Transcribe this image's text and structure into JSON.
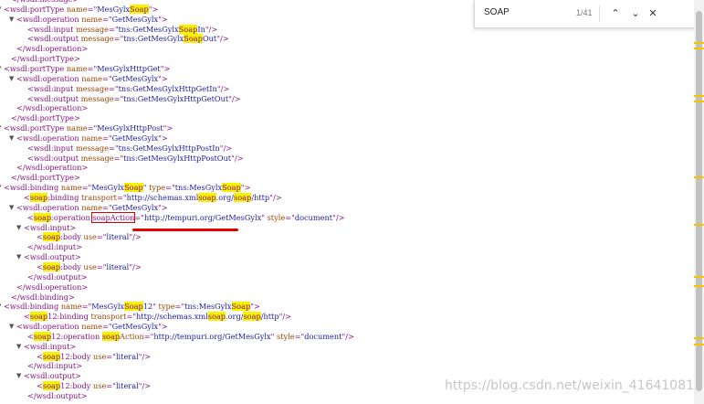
{
  "find_bar": {
    "query": "SOAP",
    "match_count": "1/41",
    "prev_icon": "chevron-up-icon",
    "next_icon": "chevron-down-icon",
    "close_icon": "close-icon",
    "prev_glyph": "⌃",
    "next_glyph": "⌄",
    "close_glyph": "✕"
  },
  "watermark": "https://blog.csdn.net/weixin_41641081",
  "colors": {
    "highlight": "#f8f200",
    "annotation": "#e60000"
  },
  "lines": [
    [
      [
        "t",
        "</wsdl:message>"
      ]
    ],
    [
      [
        "t",
        "<wsdl:portType "
      ],
      [
        "an",
        "name"
      ],
      [
        "t",
        "=\""
      ],
      [
        "av",
        "MesGylx"
      ],
      [
        "hl",
        "Soap"
      ],
      [
        "t",
        "\">"
      ]
    ],
    [
      [
        "t",
        "<wsdl:operation "
      ],
      [
        "an",
        "name"
      ],
      [
        "t",
        "=\""
      ],
      [
        "av",
        "GetMesGylx"
      ],
      [
        "t",
        "\">"
      ]
    ],
    [
      [
        "t",
        "<wsdl:input "
      ],
      [
        "an",
        "message"
      ],
      [
        "t",
        "=\""
      ],
      [
        "av",
        "tns:GetMesGylx"
      ],
      [
        "hl",
        "Soap"
      ],
      [
        "av",
        "In"
      ],
      [
        "t",
        "\"/>"
      ]
    ],
    [
      [
        "t",
        "<wsdl:output "
      ],
      [
        "an",
        "message"
      ],
      [
        "t",
        "=\""
      ],
      [
        "av",
        "tns:GetMesGylx"
      ],
      [
        "hl",
        "Soap"
      ],
      [
        "av",
        "Out"
      ],
      [
        "t",
        "\"/>"
      ]
    ],
    [
      [
        "t",
        "</wsdl:operation>"
      ]
    ],
    [
      [
        "t",
        "</wsdl:portType>"
      ]
    ],
    [
      [
        "t",
        "<wsdl:portType "
      ],
      [
        "an",
        "name"
      ],
      [
        "t",
        "=\""
      ],
      [
        "av",
        "MesGylxHttpGet"
      ],
      [
        "t",
        "\">"
      ]
    ],
    [
      [
        "t",
        "<wsdl:operation "
      ],
      [
        "an",
        "name"
      ],
      [
        "t",
        "=\""
      ],
      [
        "av",
        "GetMesGylx"
      ],
      [
        "t",
        "\">"
      ]
    ],
    [
      [
        "t",
        "<wsdl:input "
      ],
      [
        "an",
        "message"
      ],
      [
        "t",
        "=\""
      ],
      [
        "av",
        "tns:GetMesGylxHttpGetIn"
      ],
      [
        "t",
        "\"/>"
      ]
    ],
    [
      [
        "t",
        "<wsdl:output "
      ],
      [
        "an",
        "message"
      ],
      [
        "t",
        "=\""
      ],
      [
        "av",
        "tns:GetMesGylxHttpGetOut"
      ],
      [
        "t",
        "\"/>"
      ]
    ],
    [
      [
        "t",
        "</wsdl:operation>"
      ]
    ],
    [
      [
        "t",
        "</wsdl:portType>"
      ]
    ],
    [
      [
        "t",
        "<wsdl:portType "
      ],
      [
        "an",
        "name"
      ],
      [
        "t",
        "=\""
      ],
      [
        "av",
        "MesGylxHttpPost"
      ],
      [
        "t",
        "\">"
      ]
    ],
    [
      [
        "t",
        "<wsdl:operation "
      ],
      [
        "an",
        "name"
      ],
      [
        "t",
        "=\""
      ],
      [
        "av",
        "GetMesGylx"
      ],
      [
        "t",
        "\">"
      ]
    ],
    [
      [
        "t",
        "<wsdl:input "
      ],
      [
        "an",
        "message"
      ],
      [
        "t",
        "=\""
      ],
      [
        "av",
        "tns:GetMesGylxHttpPostIn"
      ],
      [
        "t",
        "\"/>"
      ]
    ],
    [
      [
        "t",
        "<wsdl:output "
      ],
      [
        "an",
        "message"
      ],
      [
        "t",
        "=\""
      ],
      [
        "av",
        "tns:GetMesGylxHttpPostOut"
      ],
      [
        "t",
        "\"/>"
      ]
    ],
    [
      [
        "t",
        "</wsdl:operation>"
      ]
    ],
    [
      [
        "t",
        "</wsdl:portType>"
      ]
    ],
    [
      [
        "t",
        "<wsdl:binding "
      ],
      [
        "an",
        "name"
      ],
      [
        "t",
        "=\""
      ],
      [
        "av",
        "MesGylx"
      ],
      [
        "hl",
        "Soap"
      ],
      [
        "t",
        "\" "
      ],
      [
        "an",
        "type"
      ],
      [
        "t",
        "=\""
      ],
      [
        "av",
        "tns:MesGylx"
      ],
      [
        "hl",
        "Soap"
      ],
      [
        "t",
        "\">"
      ]
    ],
    [
      [
        "t",
        "<"
      ],
      [
        "hl",
        "soap"
      ],
      [
        "t",
        ":binding "
      ],
      [
        "an",
        "transport"
      ],
      [
        "t",
        "=\""
      ],
      [
        "av",
        "http://schemas.xml"
      ],
      [
        "hl",
        "soap"
      ],
      [
        "av",
        ".org/"
      ],
      [
        "hl",
        "soap"
      ],
      [
        "av",
        "/http"
      ],
      [
        "t",
        "\"/>"
      ]
    ],
    [
      [
        "t",
        "<wsdl:operation "
      ],
      [
        "an",
        "name"
      ],
      [
        "t",
        "=\""
      ],
      [
        "av",
        "GetMesGylx"
      ],
      [
        "t",
        "\">"
      ]
    ],
    [
      [
        "t",
        "<"
      ],
      [
        "hl",
        "soap"
      ],
      [
        "t",
        ":operation "
      ],
      [
        "cur",
        "soapAction"
      ],
      [
        "t",
        "=\""
      ],
      [
        "av",
        "http://tempuri.org/GetMesGylx"
      ],
      [
        "t",
        "\" "
      ],
      [
        "an",
        "style"
      ],
      [
        "t",
        "=\""
      ],
      [
        "av",
        "document"
      ],
      [
        "t",
        "\"/>"
      ]
    ],
    [
      [
        "t",
        "<wsdl:input>"
      ]
    ],
    [
      [
        "t",
        "<"
      ],
      [
        "hl",
        "soap"
      ],
      [
        "t",
        ":body "
      ],
      [
        "an",
        "use"
      ],
      [
        "t",
        "=\""
      ],
      [
        "av",
        "literal"
      ],
      [
        "t",
        "\"/>"
      ]
    ],
    [
      [
        "t",
        "</wsdl:input>"
      ]
    ],
    [
      [
        "t",
        "<wsdl:output>"
      ]
    ],
    [
      [
        "t",
        "<"
      ],
      [
        "hl",
        "soap"
      ],
      [
        "t",
        ":body "
      ],
      [
        "an",
        "use"
      ],
      [
        "t",
        "=\""
      ],
      [
        "av",
        "literal"
      ],
      [
        "t",
        "\"/>"
      ]
    ],
    [
      [
        "t",
        "</wsdl:output>"
      ]
    ],
    [
      [
        "t",
        "</wsdl:operation>"
      ]
    ],
    [
      [
        "t",
        "</wsdl:binding>"
      ]
    ],
    [
      [
        "t",
        "<wsdl:binding "
      ],
      [
        "an",
        "name"
      ],
      [
        "t",
        "=\""
      ],
      [
        "av",
        "MesGylx"
      ],
      [
        "hl",
        "Soap"
      ],
      [
        "av",
        "12"
      ],
      [
        "t",
        "\" "
      ],
      [
        "an",
        "type"
      ],
      [
        "t",
        "=\""
      ],
      [
        "av",
        "tns:MesGylx"
      ],
      [
        "hl",
        "Soap"
      ],
      [
        "t",
        "\">"
      ]
    ],
    [
      [
        "t",
        "<"
      ],
      [
        "hl",
        "soap"
      ],
      [
        "t",
        "12:binding "
      ],
      [
        "an",
        "transport"
      ],
      [
        "t",
        "=\""
      ],
      [
        "av",
        "http://schemas.xml"
      ],
      [
        "hl",
        "soap"
      ],
      [
        "av",
        ".org/"
      ],
      [
        "hl",
        "soap"
      ],
      [
        "av",
        "/http"
      ],
      [
        "t",
        "\"/>"
      ]
    ],
    [
      [
        "t",
        "<wsdl:operation "
      ],
      [
        "an",
        "name"
      ],
      [
        "t",
        "=\""
      ],
      [
        "av",
        "GetMesGylx"
      ],
      [
        "t",
        "\">"
      ]
    ],
    [
      [
        "t",
        "<"
      ],
      [
        "hl",
        "soap"
      ],
      [
        "t",
        "12:operation "
      ],
      [
        "hl",
        "soap"
      ],
      [
        "an",
        "Action"
      ],
      [
        "t",
        "=\""
      ],
      [
        "av",
        "http://tempuri.org/GetMesGylx"
      ],
      [
        "t",
        "\" "
      ],
      [
        "an",
        "style"
      ],
      [
        "t",
        "=\""
      ],
      [
        "av",
        "document"
      ],
      [
        "t",
        "\"/>"
      ]
    ],
    [
      [
        "t",
        "<wsdl:input>"
      ]
    ],
    [
      [
        "t",
        "<"
      ],
      [
        "hl",
        "soap"
      ],
      [
        "t",
        "12:body "
      ],
      [
        "an",
        "use"
      ],
      [
        "t",
        "=\""
      ],
      [
        "av",
        "literal"
      ],
      [
        "t",
        "\"/>"
      ]
    ],
    [
      [
        "t",
        "</wsdl:input>"
      ]
    ],
    [
      [
        "t",
        "<wsdl:output>"
      ]
    ],
    [
      [
        "t",
        "<"
      ],
      [
        "hl",
        "soap"
      ],
      [
        "t",
        "12:body "
      ],
      [
        "an",
        "use"
      ],
      [
        "t",
        "=\""
      ],
      [
        "av",
        "literal"
      ],
      [
        "t",
        "\"/>"
      ]
    ],
    [
      [
        "t",
        "</wsdl:output>"
      ]
    ]
  ]
}
